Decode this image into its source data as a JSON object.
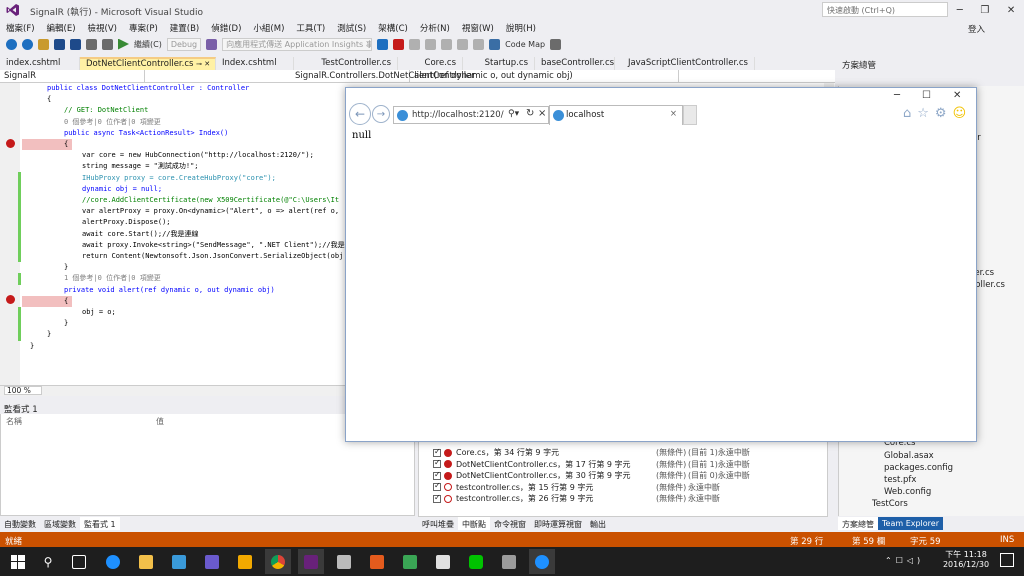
{
  "window": {
    "title": "SignalR (執行) - Microsoft Visual Studio",
    "quick_launch_placeholder": "快速啟動 (Ctrl+Q)",
    "login": "登入"
  },
  "menu": [
    "檔案(F)",
    "編輯(E)",
    "檢視(V)",
    "專案(P)",
    "建置(B)",
    "偵錯(D)",
    "小組(M)",
    "工具(T)",
    "測試(S)",
    "架構(C)",
    "分析(N)",
    "視窗(W)",
    "說明(H)"
  ],
  "toolbar": {
    "continue_label": "繼續(C)",
    "config": "Debug",
    "insights_label": "向應用程式傳送 Application Insights 事件",
    "codemap_label": "Code Map"
  },
  "tabs": [
    "index.cshtml",
    "DotNetClientController.cs",
    "Index.cshtml",
    "TestController.cs",
    "Core.cs",
    "Startup.cs",
    "baseController.cs",
    "JavaScriptClientController.cs"
  ],
  "active_tab": 1,
  "nav": {
    "project": "SignalR",
    "type": "SignalR.Controllers.DotNetClientController",
    "member": "alert(ref dynamic o, out dynamic obj)"
  },
  "code": {
    "l0": "public class DotNetClientController : Controller",
    "l1": "{",
    "l2": "// GET: DotNetClient",
    "l3": "0 個參考|0 位作者|0 項變更",
    "l4": "public async Task<ActionResult> Index()",
    "l5": "{",
    "l6": "var core = new HubConnection(\"http://localhost:2120/\");",
    "l7": "string message = \"測試成功!\";",
    "l8": "IHubProxy proxy = core.CreateHubProxy(\"core\");",
    "l9": "dynamic obj = null;",
    "l10": "//core.AddClientCertificate(new X509Certificate(@\"C:\\Users\\It",
    "l11": "var alertProxy = proxy.On<dynamic>(\"Alert\", o => alert(ref o,",
    "l12": "alertProxy.Dispose();",
    "l13": "await core.Start();//我是連線",
    "l14": "await proxy.Invoke<string>(\"SendMessage\", \".NET Client\");//我是",
    "l15": "return Content(Newtonsoft.Json.JsonConvert.SerializeObject(obj",
    "l16": "}",
    "l17": "1 個參考|0 位作者|0 項變更",
    "l18": "private void alert(ref dynamic o, out dynamic obj)",
    "l19": "{",
    "l20": "obj = o;",
    "l21": "}",
    "l22": "}",
    "l23": "}"
  },
  "zoom": "100 %",
  "watch": {
    "title": "監看式 1",
    "col_name": "名稱",
    "col_value": "值"
  },
  "bottom_tabs_left": [
    "自動變數",
    "區域變數",
    "監看式 1"
  ],
  "bottom_tabs_right": [
    "呼叫堆疊",
    "中斷點",
    "命令視窗",
    "即時運算視窗",
    "輸出"
  ],
  "breakpoints": [
    {
      "name": "Core.cs，第 34 行第 9 字元",
      "cond": "(無條件)",
      "hit": "(目前 1)永遠中斷",
      "icon": "red"
    },
    {
      "name": "DotNetClientController.cs，第 17 行第 9 字元",
      "cond": "(無條件)",
      "hit": "(目前 1)永遠中斷",
      "icon": "red"
    },
    {
      "name": "DotNetClientController.cs，第 30 行第 9 字元",
      "cond": "(無條件)",
      "hit": "(目前 0)永遠中斷",
      "icon": "red"
    },
    {
      "name": "testcontroller.cs，第 15 行第 9 字元",
      "cond": "(無條件)",
      "hit": "永遠中斷",
      "icon": "q"
    },
    {
      "name": "testcontroller.cs，第 26 行第 9 字元",
      "cond": "(無條件)",
      "hit": "永遠中斷",
      "icon": "q"
    }
  ],
  "solution": {
    "title": "方案總管",
    "items": [
      "Core.cs",
      "Global.asax",
      "packages.config",
      "test.pfx",
      "Web.config",
      "TestCors"
    ],
    "partial": [
      "er",
      "ler.cs",
      "roller.cs"
    ],
    "tabs": [
      "方案總管",
      "Team Explorer"
    ]
  },
  "status": {
    "left": "就緒",
    "line": "第 29 行",
    "col": "第 59 欄",
    "char": "字元 59",
    "ins": "INS"
  },
  "clock": {
    "time": "下午 11:18",
    "date": "2016/12/30"
  },
  "ie": {
    "url": "http://localhost:2120/",
    "tab_title": "localhost",
    "content": "null"
  }
}
